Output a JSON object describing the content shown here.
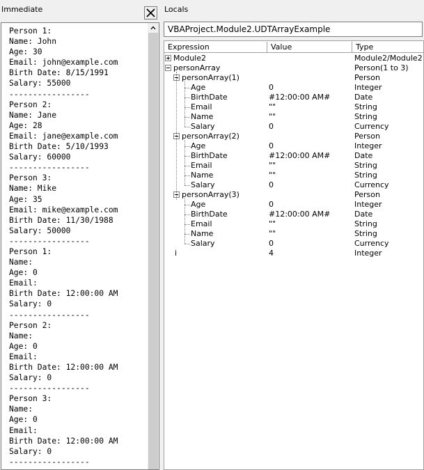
{
  "immediate": {
    "title": "Immediate",
    "lines": [
      "Person 1:",
      "Name: John",
      "Age: 30",
      "Email: john@example.com",
      "Birth Date: 8/15/1991",
      "Salary: 55000",
      "-----------------",
      "Person 2:",
      "Name: Jane",
      "Age: 28",
      "Email: jane@example.com",
      "Birth Date: 5/10/1993",
      "Salary: 60000",
      "-----------------",
      "Person 3:",
      "Name: Mike",
      "Age: 35",
      "Email: mike@example.com",
      "Birth Date: 11/30/1988",
      "Salary: 50000",
      "-----------------",
      "Person 1:",
      "Name:",
      "Age: 0",
      "Email:",
      "Birth Date: 12:00:00 AM",
      "Salary: 0",
      "-----------------",
      "Person 2:",
      "Name:",
      "Age: 0",
      "Email:",
      "Birth Date: 12:00:00 AM",
      "Salary: 0",
      "-----------------",
      "Person 3:",
      "Name:",
      "Age: 0",
      "Email:",
      "Birth Date: 12:00:00 AM",
      "Salary: 0",
      "-----------------"
    ]
  },
  "locals": {
    "title": "Locals",
    "context": "VBAProject.Module2.UDTArrayExample",
    "columns": {
      "expression": "Expression",
      "value": "Value",
      "type": "Type"
    },
    "rows": [
      {
        "expr": "Module2",
        "value": "",
        "type": "Module2/Module2",
        "level": 0,
        "expander": "plus"
      },
      {
        "expr": "personArray",
        "value": "",
        "type": "Person(1 to 3)",
        "level": 0,
        "expander": "minus"
      },
      {
        "expr": "personArray(1)",
        "value": "",
        "type": "Person",
        "level": 1,
        "expander": "minus"
      },
      {
        "expr": "Age",
        "value": "0",
        "type": "Integer",
        "level": 2,
        "expander": ""
      },
      {
        "expr": "BirthDate",
        "value": "#12:00:00 AM#",
        "type": "Date",
        "level": 2,
        "expander": ""
      },
      {
        "expr": "Email",
        "value": "\"\"",
        "type": "String",
        "level": 2,
        "expander": ""
      },
      {
        "expr": "Name",
        "value": "\"\"",
        "type": "String",
        "level": 2,
        "expander": ""
      },
      {
        "expr": "Salary",
        "value": "0",
        "type": "Currency",
        "level": 2,
        "expander": ""
      },
      {
        "expr": "personArray(2)",
        "value": "",
        "type": "Person",
        "level": 1,
        "expander": "minus"
      },
      {
        "expr": "Age",
        "value": "0",
        "type": "Integer",
        "level": 2,
        "expander": ""
      },
      {
        "expr": "BirthDate",
        "value": "#12:00:00 AM#",
        "type": "Date",
        "level": 2,
        "expander": ""
      },
      {
        "expr": "Email",
        "value": "\"\"",
        "type": "String",
        "level": 2,
        "expander": ""
      },
      {
        "expr": "Name",
        "value": "\"\"",
        "type": "String",
        "level": 2,
        "expander": ""
      },
      {
        "expr": "Salary",
        "value": "0",
        "type": "Currency",
        "level": 2,
        "expander": ""
      },
      {
        "expr": "personArray(3)",
        "value": "",
        "type": "Person",
        "level": 1,
        "expander": "minus"
      },
      {
        "expr": "Age",
        "value": "0",
        "type": "Integer",
        "level": 2,
        "expander": ""
      },
      {
        "expr": "BirthDate",
        "value": "#12:00:00 AM#",
        "type": "Date",
        "level": 2,
        "expander": ""
      },
      {
        "expr": "Email",
        "value": "\"\"",
        "type": "String",
        "level": 2,
        "expander": ""
      },
      {
        "expr": "Name",
        "value": "\"\"",
        "type": "String",
        "level": 2,
        "expander": ""
      },
      {
        "expr": "Salary",
        "value": "0",
        "type": "Currency",
        "level": 2,
        "expander": ""
      },
      {
        "expr": "i",
        "value": "4",
        "type": "Integer",
        "level": 0,
        "expander": ""
      }
    ]
  },
  "icons": {
    "close": "close-icon",
    "scroll_up": "chevron-up-icon",
    "expand": "plus-box-icon",
    "collapse": "minus-box-icon"
  }
}
